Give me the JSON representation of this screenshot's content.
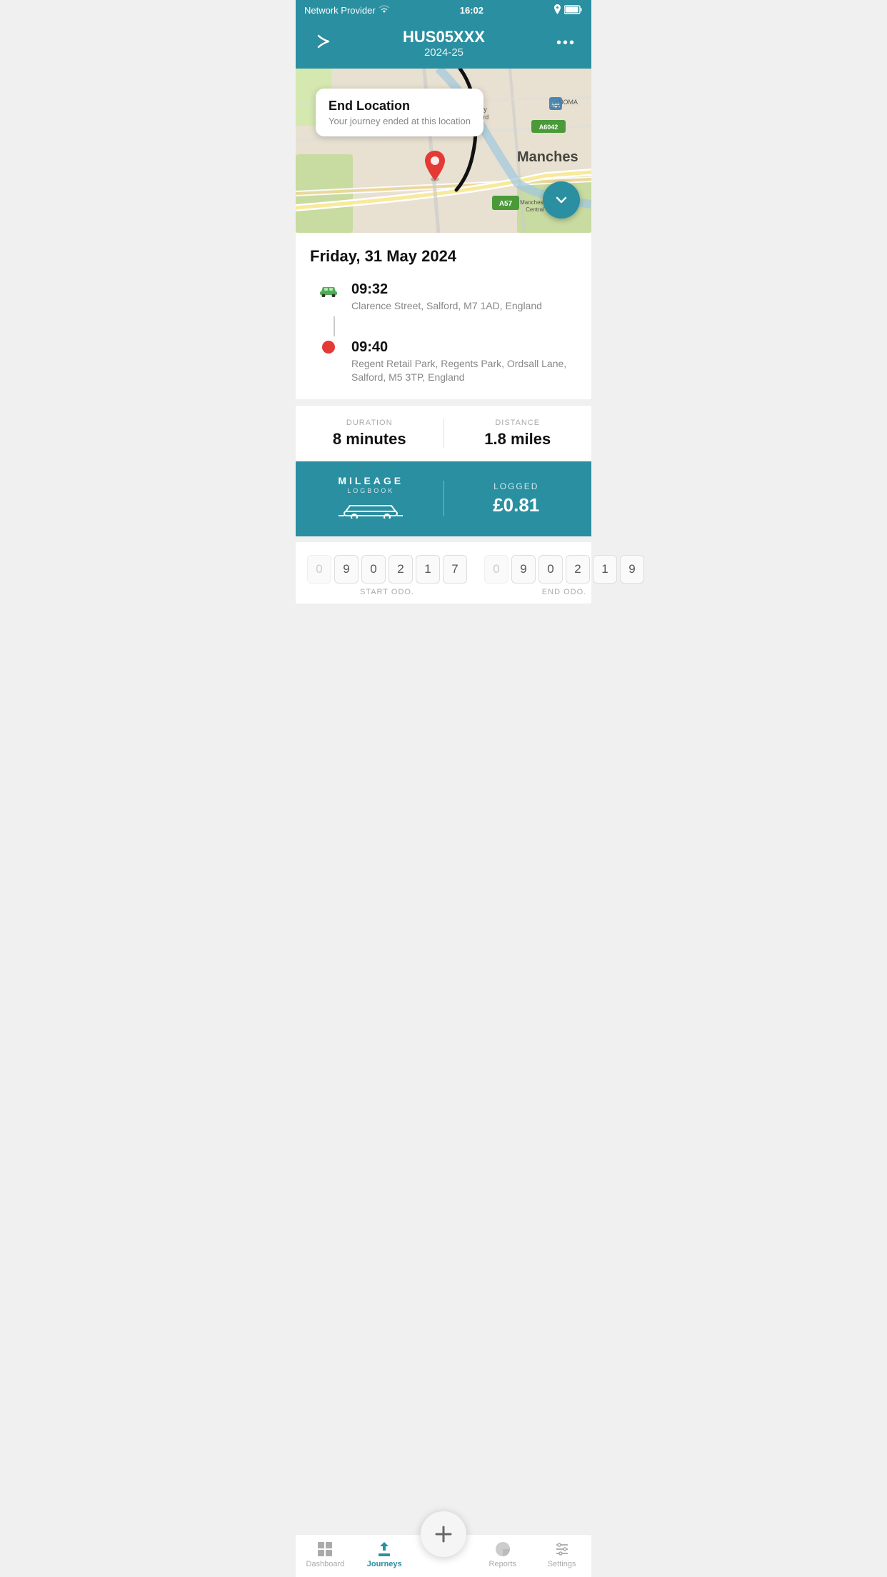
{
  "statusBar": {
    "carrier": "Network Provider",
    "time": "16:02",
    "icons": {
      "wifi": "wifi",
      "location": "location",
      "battery": "battery"
    }
  },
  "header": {
    "back_label": "←",
    "vehicle_id": "HUS05XXX",
    "year": "2024-25",
    "more_label": "•••"
  },
  "map": {
    "end_location_title": "End Location",
    "end_location_subtitle": "Your journey ended at this location",
    "manchester_label": "Manchester",
    "manchester_central_label": "Manchester\nCentral"
  },
  "journey": {
    "date": "Friday, 31 May 2024",
    "start": {
      "time": "09:32",
      "address": "Clarence Street, Salford, M7 1AD, England"
    },
    "end": {
      "time": "09:40",
      "address": "Regent Retail Park, Regents Park, Ordsall Lane, Salford, M5 3TP, England"
    }
  },
  "stats": {
    "duration_label": "DURATION",
    "duration_value": "8 minutes",
    "distance_label": "DISTANCE",
    "distance_value": "1.8 miles"
  },
  "mileage": {
    "logo_text": "MILEAGE",
    "logo_sub": "LOGBOOK",
    "logged_label": "LOGGED",
    "logged_amount": "£0.81"
  },
  "odometer": {
    "start_label": "START ODO.",
    "start_digits": [
      "0",
      "9",
      "0",
      "2",
      "1",
      "7"
    ],
    "start_dims": [
      true,
      false,
      false,
      false,
      false,
      false
    ],
    "end_label": "END ODO.",
    "end_digits": [
      "0",
      "9",
      "0",
      "2",
      "1",
      "9"
    ],
    "end_dims": [
      true,
      false,
      false,
      false,
      false,
      false
    ]
  },
  "nav": {
    "items": [
      {
        "label": "Dashboard",
        "icon": "grid",
        "active": false
      },
      {
        "label": "Journeys",
        "icon": "journey",
        "active": true
      },
      {
        "label": "",
        "icon": "plus",
        "active": false
      },
      {
        "label": "Reports",
        "icon": "chart",
        "active": false
      },
      {
        "label": "Settings",
        "icon": "settings",
        "active": false
      }
    ]
  }
}
